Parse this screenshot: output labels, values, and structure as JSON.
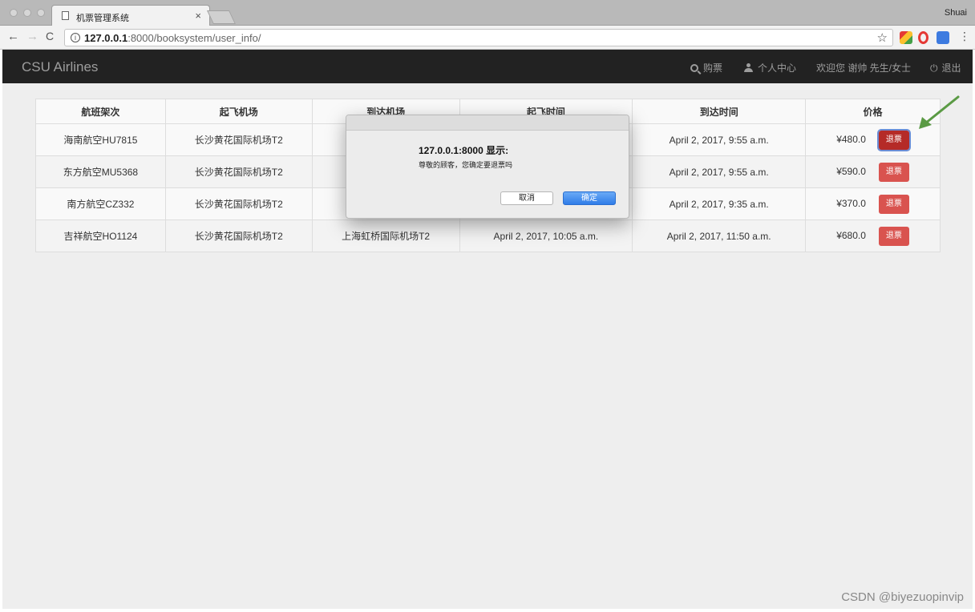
{
  "browser": {
    "tab_title": "机票管理系统",
    "tab_close": "×",
    "profile": "Shuai",
    "url_host": "127.0.0.1",
    "url_path": ":8000/booksystem/user_info/"
  },
  "nav": {
    "brand": "CSU Airlines",
    "buy": "购票",
    "profile": "个人中心",
    "welcome": "欢迎您 谢帅 先生/女士",
    "logout": "退出"
  },
  "table": {
    "headers": [
      "航班架次",
      "起飞机场",
      "到达机场",
      "起飞时间",
      "到达时间",
      "价格"
    ],
    "rows": [
      {
        "flight": "海南航空HU7815",
        "from": "长沙黄花国际机场T2",
        "to": "",
        "dep": "",
        "arr": "April 2, 2017, 9:55 a.m.",
        "price": "¥480.0",
        "action": "退票"
      },
      {
        "flight": "东方航空MU5368",
        "from": "长沙黄花国际机场T2",
        "to": "",
        "dep": "",
        "arr": "April 2, 2017, 9:55 a.m.",
        "price": "¥590.0",
        "action": "退票"
      },
      {
        "flight": "南方航空CZ332",
        "from": "长沙黄花国际机场T2",
        "to": "",
        "dep": "",
        "arr": "April 2, 2017, 9:35 a.m.",
        "price": "¥370.0",
        "action": "退票"
      },
      {
        "flight": "吉祥航空HO1124",
        "from": "长沙黄花国际机场T2",
        "to": "上海虹桥国际机场T2",
        "dep": "April 2, 2017, 10:05 a.m.",
        "arr": "April 2, 2017, 11:50 a.m.",
        "price": "¥680.0",
        "action": "退票"
      }
    ]
  },
  "dialog": {
    "origin": "127.0.0.1:8000 显示:",
    "message": "尊敬的顾客，您确定要退票吗",
    "cancel": "取消",
    "ok": "确定"
  },
  "watermark": "CSDN @biyezuopinvip",
  "colors": {
    "navbar": "#222222",
    "danger": "#d9534f",
    "annotation_arrow": "#5a9a44",
    "dialog_ok": "#2f7ce8"
  }
}
